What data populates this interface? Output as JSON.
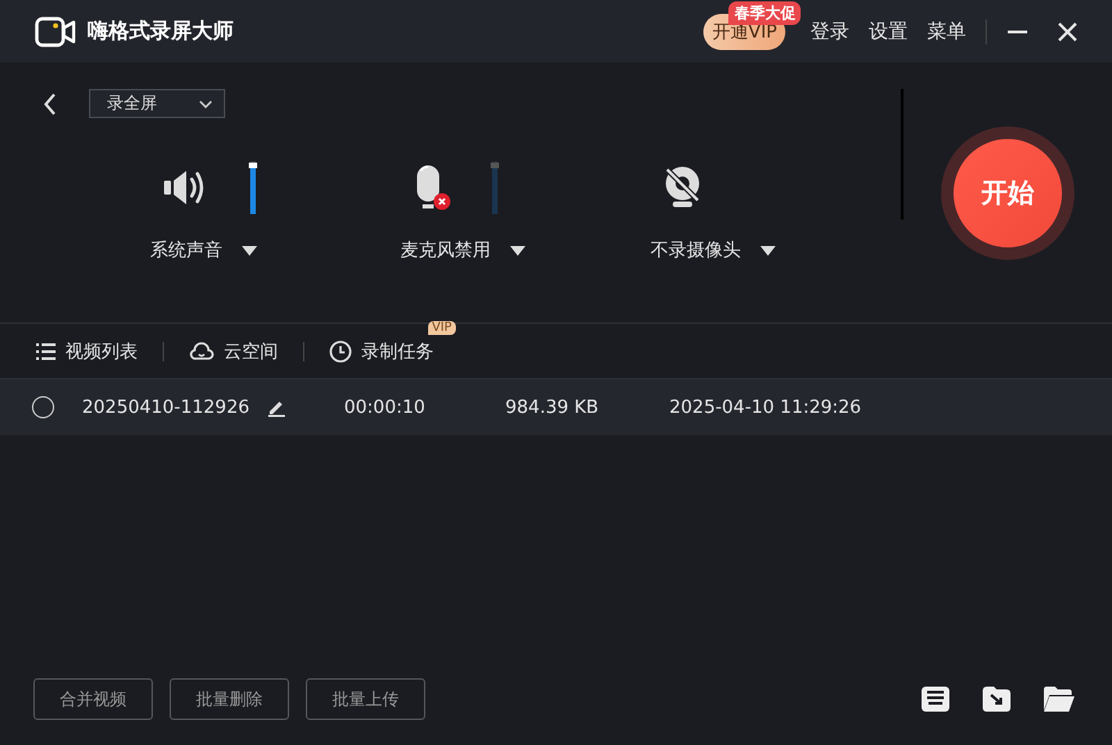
{
  "window": {
    "title": "嗨格式录屏大师"
  },
  "header": {
    "vip_button": "开通VIP",
    "promo_badge": "春季大促",
    "links": [
      "登录",
      "设置",
      "菜单"
    ]
  },
  "mode_select": {
    "value": "录全屏"
  },
  "devices": [
    {
      "kind": "speaker",
      "label": "系统声音",
      "disabled": false
    },
    {
      "kind": "mic",
      "label": "麦克风禁用",
      "disabled": true
    },
    {
      "kind": "camera",
      "label": "不录摄像头"
    }
  ],
  "start_button": "开始",
  "tabs": [
    {
      "kind": "list",
      "label": "视频列表"
    },
    {
      "kind": "cloud",
      "label": "云空间"
    },
    {
      "kind": "clock",
      "label": "录制任务",
      "badge": "VIP"
    }
  ],
  "files": [
    {
      "name": "20250410-112926",
      "duration": "00:00:10",
      "size": "984.39 KB",
      "date": "2025-04-10 11:29:26",
      "selected": false
    }
  ],
  "bottom_buttons": [
    "合并视频",
    "批量删除",
    "批量上传"
  ]
}
